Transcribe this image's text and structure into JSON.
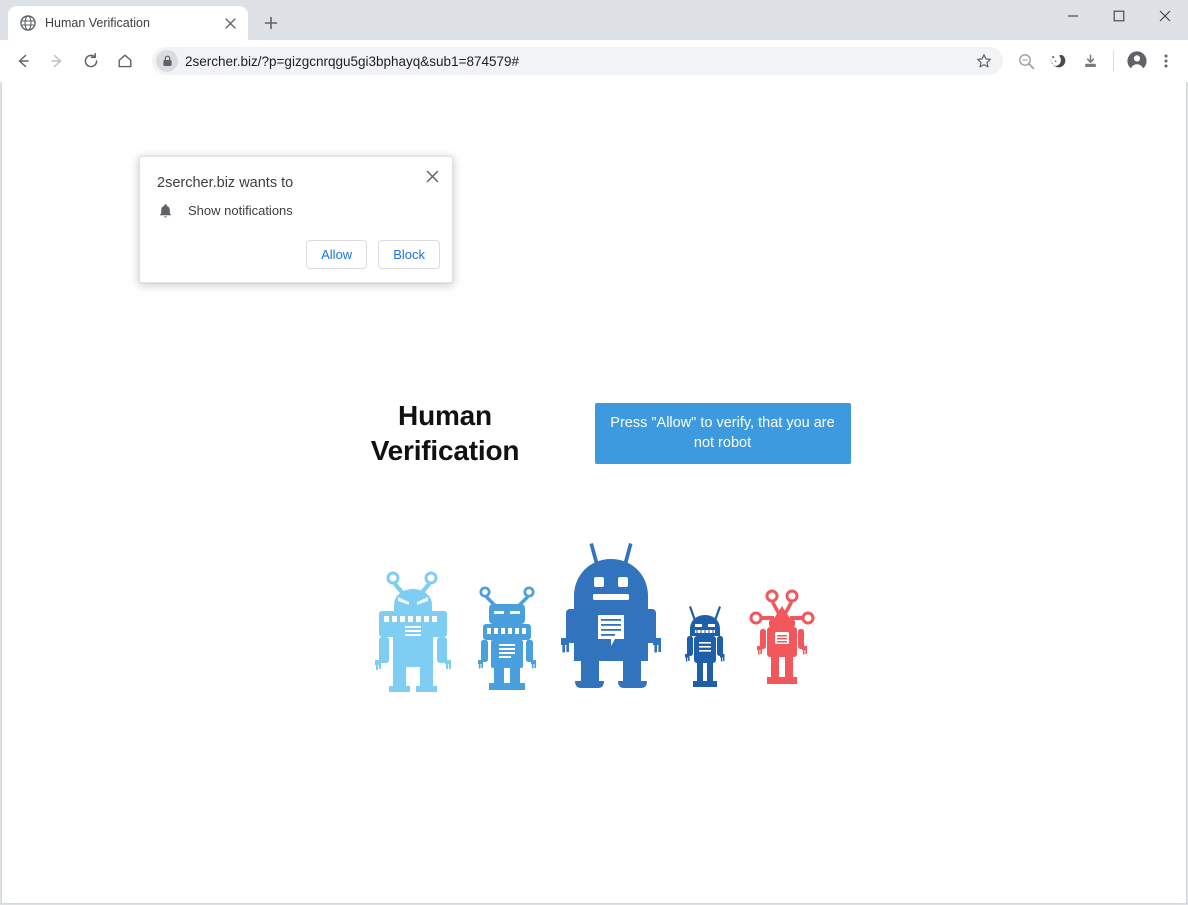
{
  "window": {
    "controls": [
      {
        "name": "minimize",
        "glyph": "minimize-icon"
      },
      {
        "name": "maximize",
        "glyph": "maximize-icon"
      },
      {
        "name": "close",
        "glyph": "close-icon"
      }
    ]
  },
  "tabstrip": {
    "tab_title": "Human Verification",
    "favicon": "globe-icon",
    "close_icon": "close-icon",
    "new_tab_icon": "plus-icon"
  },
  "toolbar": {
    "back_icon": "arrow-left-icon",
    "forward_icon": "arrow-right-icon",
    "reload_icon": "reload-icon",
    "home_icon": "home-icon",
    "lock_icon": "lock-icon",
    "url": "2sercher.biz/?p=gizgcnrqgu5gi3bphayq&sub1=874579#",
    "url_domain": "2sercher.biz",
    "url_path": "/?p=gizgcnrqgu5gi3bphayq&sub1=874579#",
    "star_icon": "star-icon",
    "extensions": [
      {
        "name": "search-extension-icon"
      },
      {
        "name": "adblock-extension-icon"
      },
      {
        "name": "download-extension-icon"
      }
    ],
    "profile_icon": "account-circle-icon",
    "menu_icon": "three-dot-menu-icon"
  },
  "permission_dialog": {
    "title": "2sercher.biz wants to",
    "permission_icon": "bell-icon",
    "permission_label": "Show notifications",
    "allow_label": "Allow",
    "block_label": "Block",
    "close_icon": "close-icon"
  },
  "page": {
    "heading_line1": "Human",
    "heading_line2": "Verification",
    "cta_text": "Press \"Allow\" to verify, that you are not robot",
    "robots": [
      {
        "name": "robot-light-blue",
        "color": "#7ecef4"
      },
      {
        "name": "robot-medium-blue",
        "color": "#4a9fde"
      },
      {
        "name": "robot-large-blue",
        "color": "#3273bd"
      },
      {
        "name": "robot-small-navy",
        "color": "#1f5fa9"
      },
      {
        "name": "robot-red",
        "color": "#f2585b"
      }
    ]
  },
  "colors": {
    "accent_blue": "#1a73e8",
    "cta_blue": "#3d9ade",
    "chrome_frame": "#dee1e6",
    "toolbar_bg": "#ffffff",
    "omnibox_bg": "#f1f3f4"
  }
}
